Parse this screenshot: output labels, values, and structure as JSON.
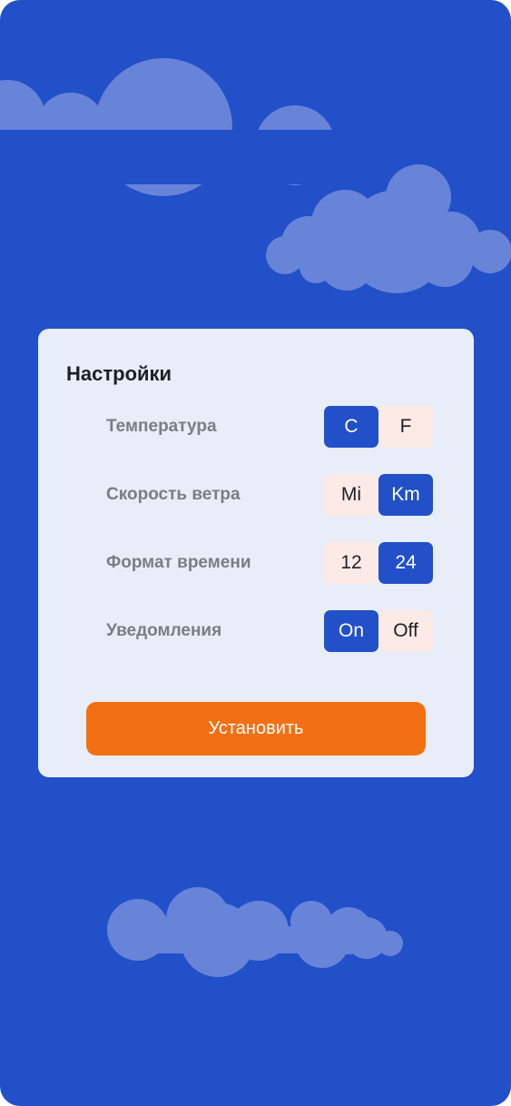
{
  "colors": {
    "background": "#2150c8",
    "cloud": "#6784d9",
    "card": "#e9edf8",
    "toggle_active": "#2150c8",
    "toggle_inactive": "#fbeae6",
    "button": "#f27013"
  },
  "settings": {
    "title": "Настройки",
    "rows": [
      {
        "label": "Температура",
        "options": [
          "C",
          "F"
        ],
        "selected": "C"
      },
      {
        "label": "Скорость ветра",
        "options": [
          "Mi",
          "Km"
        ],
        "selected": "Km"
      },
      {
        "label": "Формат времени",
        "options": [
          "12",
          "24"
        ],
        "selected": "24"
      },
      {
        "label": "Уведомления",
        "options": [
          "On",
          "Off"
        ],
        "selected": "On"
      }
    ],
    "submit_label": "Установить"
  }
}
